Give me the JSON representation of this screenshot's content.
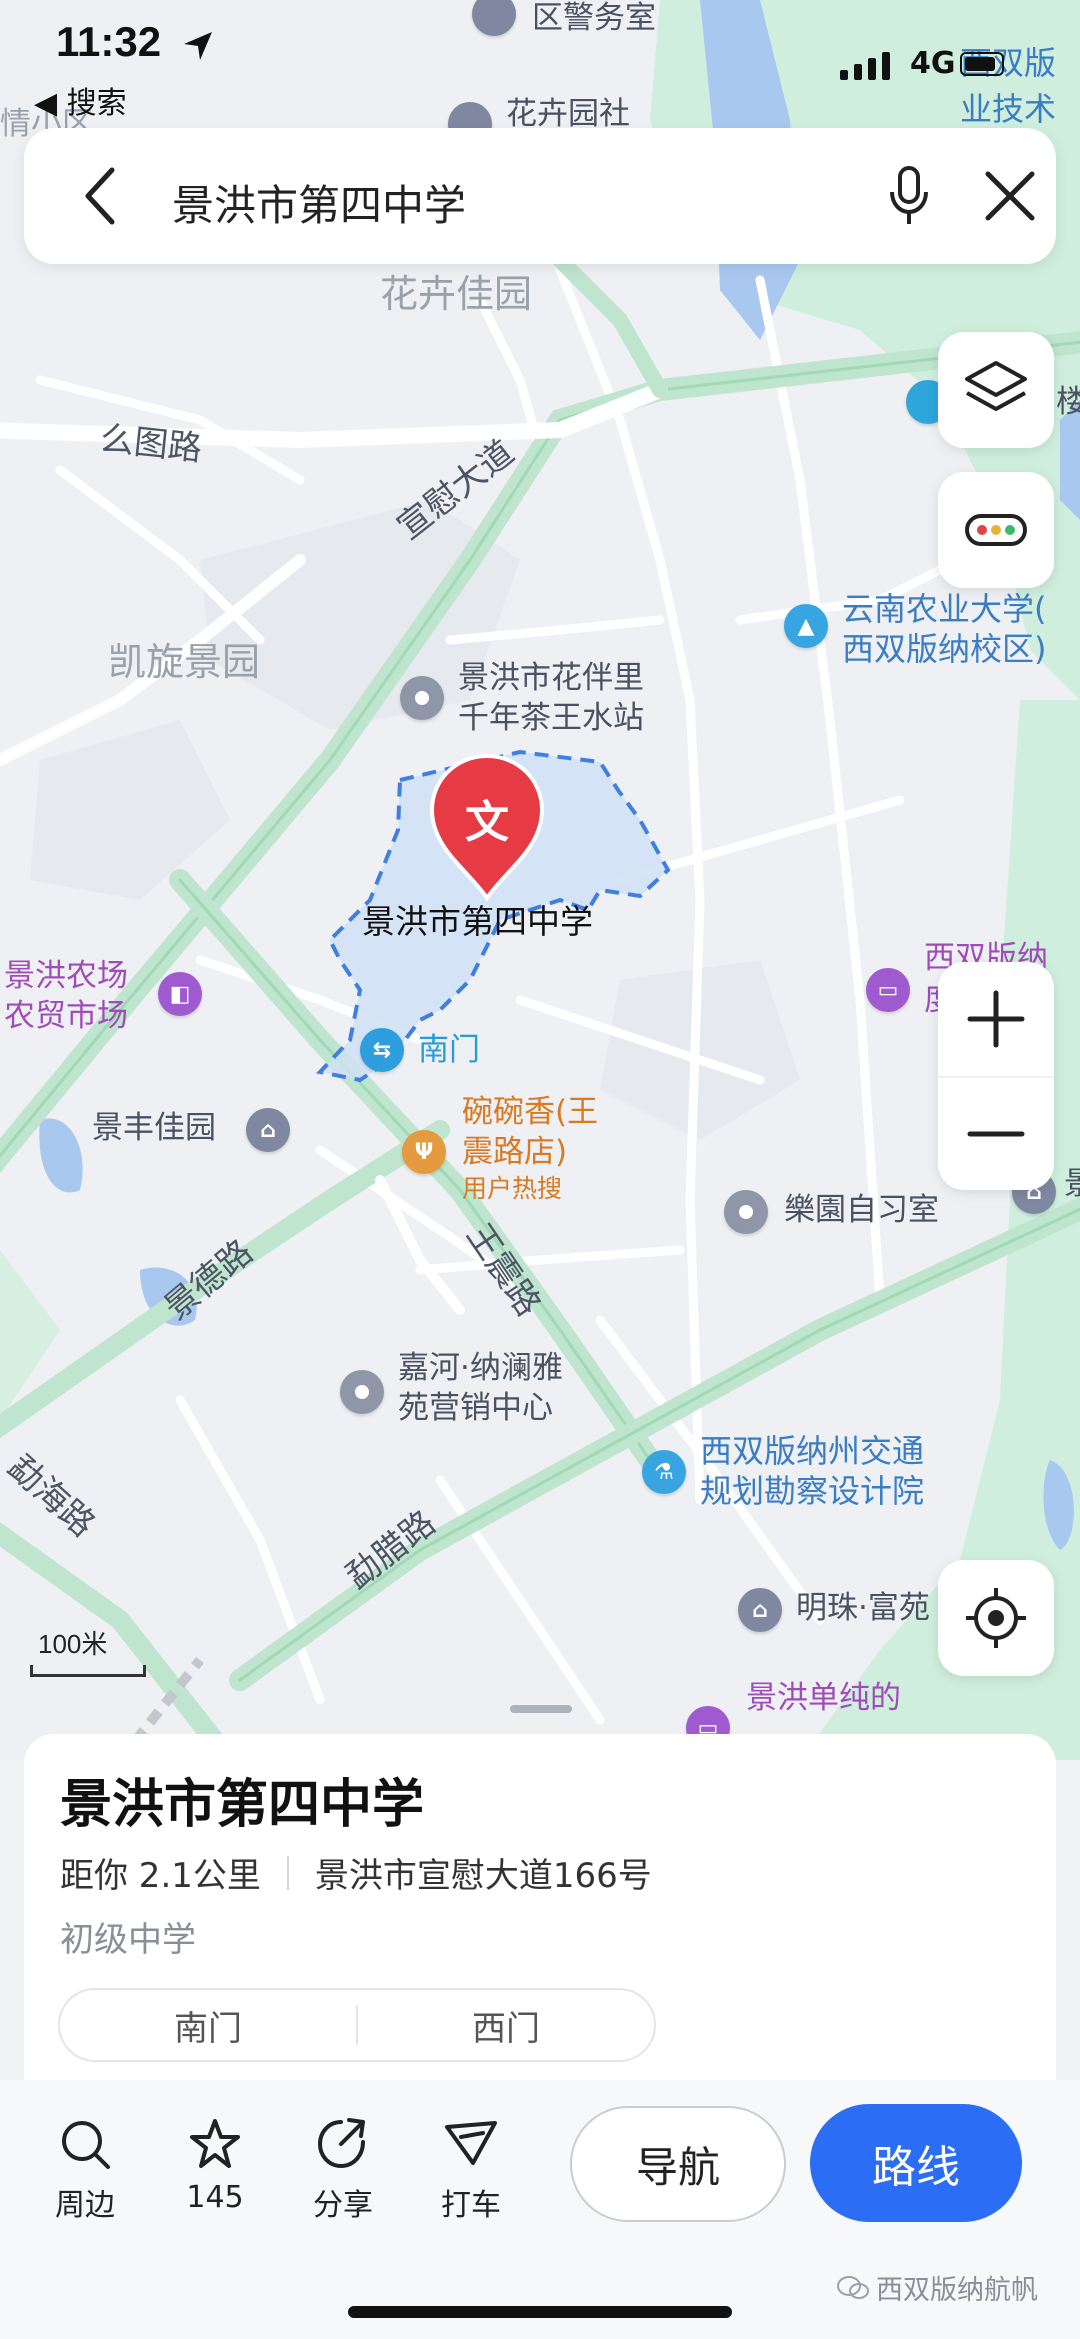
{
  "status_bar": {
    "time": "11:32",
    "back_app": "◀ 搜索",
    "network": "4G"
  },
  "search": {
    "query": "景洪市第四中学"
  },
  "map": {
    "roads": [
      "么图路",
      "宣慰大道",
      "王震路",
      "景德路",
      "勐海路",
      "勐腊路"
    ],
    "areas": [
      "花卉佳园",
      "凯旋景园"
    ],
    "pois": {
      "police": "区警务室",
      "flower_community": "花卉园社",
      "yunnan_agri": "云南农业大学(西双版纳校区)",
      "yunnan_agri_l1": "云南农业大学(",
      "yunnan_agri_l2": "西双版纳校区)",
      "tea_l1": "景洪市花伴里",
      "tea_l2": "千年茶王水站",
      "school": "景洪市第四中学",
      "school_badge": "文",
      "farm_l1": "景洪农场",
      "farm_l2": "农贸市场",
      "south_gate": "南门",
      "bowl_l1": "碗碗香(王",
      "bowl_l2": "震路店)",
      "bowl_tag": "用户热搜",
      "jingfeng": "景丰佳园",
      "study": "樂園自习室",
      "jiahe_l1": "嘉河·纳澜雅",
      "jiahe_l2": "苑营销中心",
      "transport_l1": "西双版纳州交通",
      "transport_l2": "规划勘察设计院",
      "mingzhu": "明珠·富苑",
      "hostel": "景洪单纯的",
      "top_left": "情小区",
      "top_right_1": "西双版",
      "top_right_2": "业技术",
      "right_edge_1": "西双版纳",
      "right_edge_2": "度",
      "building": "楼",
      "right_edge_3": "景"
    },
    "scale": "100米"
  },
  "place_card": {
    "name": "景洪市第四中学",
    "distance": "距你 2.1公里",
    "address": "景洪市宣慰大道166号",
    "category": "初级中学",
    "gates": [
      "南门",
      "西门"
    ]
  },
  "bottom_bar": {
    "nearby": "周边",
    "favorites": "145",
    "share": "分享",
    "taxi": "打车",
    "navigate": "导航",
    "route": "路线"
  },
  "watermark": "西双版纳航帆"
}
